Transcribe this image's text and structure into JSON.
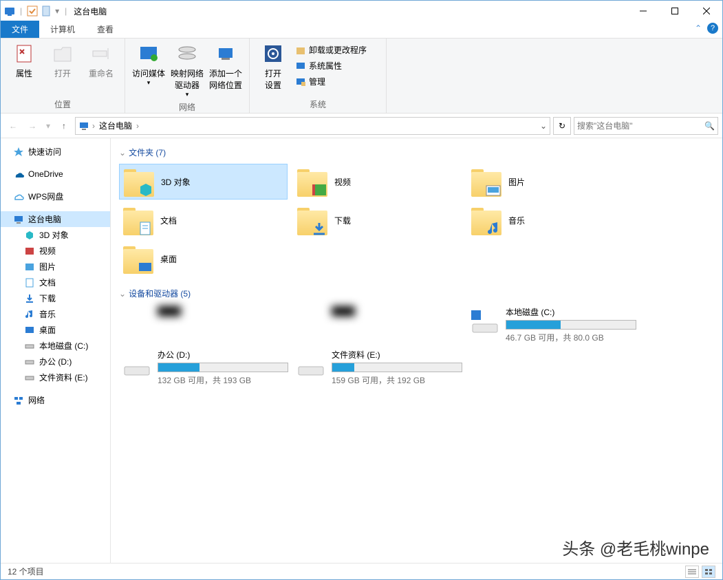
{
  "title": "这台电脑",
  "tabs": {
    "file": "文件",
    "computer": "计算机",
    "view": "查看"
  },
  "ribbon": {
    "g1": {
      "label": "位置",
      "btns": [
        "属性",
        "打开",
        "重命名"
      ]
    },
    "g2": {
      "label": "网络",
      "btns": [
        "访问媒体",
        "映射网络\n驱动器",
        "添加一个\n网络位置"
      ]
    },
    "g3": {
      "label": "系统",
      "big": "打开\n设置",
      "small": [
        "卸载或更改程序",
        "系统属性",
        "管理"
      ]
    }
  },
  "breadcrumb": {
    "root": "这台电脑"
  },
  "search": {
    "placeholder": "搜索\"这台电脑\""
  },
  "sidebar": {
    "quick": "快速访问",
    "onedrive": "OneDrive",
    "wps": "WPS网盘",
    "thispc": "这台电脑",
    "children": [
      "3D 对象",
      "视频",
      "图片",
      "文档",
      "下载",
      "音乐",
      "桌面",
      "本地磁盘 (C:)",
      "办公 (D:)",
      "文件资料 (E:)"
    ],
    "network": "网络"
  },
  "sections": {
    "folders": {
      "title": "文件夹 (7)",
      "items": [
        "3D 对象",
        "视频",
        "图片",
        "文档",
        "下载",
        "音乐",
        "桌面"
      ]
    },
    "drives": {
      "title": "设备和驱动器 (5)",
      "items": [
        {
          "name": "本地磁盘 (C:)",
          "free": "46.7 GB 可用，共 80.0 GB",
          "pct": 42
        },
        {
          "name": "办公 (D:)",
          "free": "132 GB 可用，共 193 GB",
          "pct": 32
        },
        {
          "name": "文件资料 (E:)",
          "free": "159 GB 可用，共 192 GB",
          "pct": 17
        }
      ]
    }
  },
  "status": "12 个项目",
  "watermark": "头条 @老毛桃winpe"
}
